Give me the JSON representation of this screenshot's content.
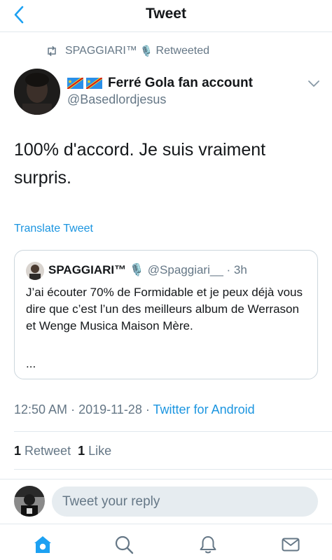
{
  "header": {
    "title": "Tweet"
  },
  "retweet_context": {
    "name": "SPAGGIARI™",
    "mic_icon": "🎙️",
    "label": "Retweeted"
  },
  "tweet": {
    "author_name": "Ferré Gola fan account",
    "author_handle": "@Basedlordjesus",
    "text": "100% d'accord. Je suis vraiment surpris.",
    "translate_label": "Translate Tweet",
    "time": "12:50 AM",
    "date": "2019-11-28",
    "source": "Twitter for Android",
    "retweet_count": "1",
    "retweet_label": "Retweet",
    "like_count": "1",
    "like_label": "Like"
  },
  "quote": {
    "name": "SPAGGIARI™",
    "mic_icon": "🎙️",
    "handle": "@Spaggiari__",
    "age": "3h",
    "text": "J’ai écouter 70% de Formidable et je peux déjà vous dire que c’est l’un des meilleurs album de Werrason et Wenge Musica Maison Mère.",
    "ellipsis": "..."
  },
  "reply": {
    "placeholder": "Tweet your reply"
  },
  "colors": {
    "accent": "#1da1f2",
    "link": "#1b95e0",
    "muted": "#657786",
    "divider": "#e1e8ed"
  },
  "icons": [
    "back-chevron-icon",
    "retweet-icon",
    "flag-icon",
    "caret-down-icon",
    "home-icon",
    "search-icon",
    "notifications-icon",
    "messages-icon"
  ],
  "tabs": [
    "home",
    "search",
    "notifications",
    "messages"
  ]
}
